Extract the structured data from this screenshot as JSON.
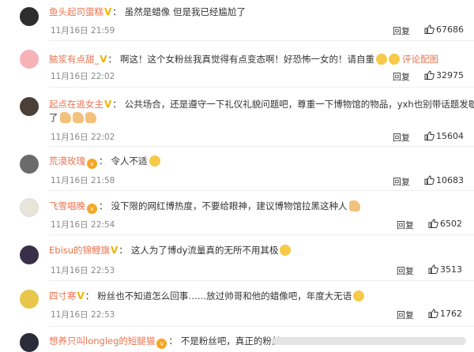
{
  "comments": [
    {
      "user": "鱼头起司蛋糕",
      "badge": "V",
      "text": "虽然是蜡像 但是我已经尴尬了",
      "time": "11月16日 21:59",
      "reply": "回复",
      "likes": "67686"
    },
    {
      "user": "脑浆有点甜_",
      "badge": "V",
      "text": "啊这！这个女粉丝我真觉得有点变态啊！好恐怖一女的！请自重",
      "link": "评论配图",
      "time": "11月16日 22:02",
      "reply": "回复",
      "likes": "32975"
    },
    {
      "user": "起点在逃女主",
      "badge": "V",
      "text": "公共场合，还是遵守一下礼仪礼貌问题吧，尊重一下博物馆的物品，yxh也别带话题发歇",
      "text2": "了",
      "time": "11月16日 22:02",
      "reply": "回复",
      "likes": "15604"
    },
    {
      "user": "荒漠玫瑰",
      "badge": "vip",
      "text": "令人不适",
      "time": "11月16日 21:58",
      "reply": "回复",
      "likes": "10683"
    },
    {
      "user": "飞雪唱晚",
      "badge": "vip",
      "text": "没下限的网红博热度，不要给眼神，建议博物馆拉黑这种人",
      "time": "11月16日 22:54",
      "reply": "回复",
      "likes": "6502"
    },
    {
      "user": "Ebisu的锦鲤旗",
      "badge": "V",
      "text": "这人为了博dy流量真的无所不用其极",
      "time": "11月16日 22:53",
      "reply": "回复",
      "likes": "3513"
    },
    {
      "user": "四寸寒",
      "badge": "V",
      "text": "粉丝也不知道怎么回事……放过帅哥和他的蜡像吧，年度大无语",
      "time": "11月16日 22:53",
      "reply": "回复",
      "likes": "1762"
    },
    {
      "user": "想养只叫longleg的短腿猫",
      "badge": "vip",
      "text": "不是粉丝吧，真正的粉丝"
    }
  ],
  "colors": {
    "username": "#eb7350",
    "badge_v": "#f0b400",
    "meta": "#888888"
  }
}
